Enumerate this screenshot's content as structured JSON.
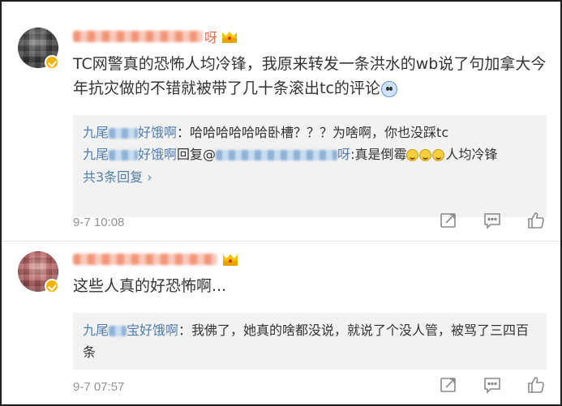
{
  "comments": [
    {
      "author_tail": "呀",
      "text": "TC网警真的恐怖人均冷锋，我原来转发一条洪水的wb说了句加拿大今年抗灾做的不错就被带了几十条滚出tc的评论",
      "replies": [
        {
          "name_prefix": "九尾",
          "name_suffix": "好饿啊",
          "sep": "：",
          "content": "哈哈哈哈哈哈卧槽？？？为啥啊，你也没踩tc"
        },
        {
          "name_prefix": "九尾",
          "name_suffix": "好饿啊",
          "reply_word": "回复@",
          "target_tail": "呀",
          "sep": ":",
          "content": "真是倒霉",
          "content_tail": "人均冷锋"
        }
      ],
      "more_replies": "共3条回复 ›",
      "time": "9-7 10:08"
    },
    {
      "author_tail": "",
      "text": "这些人真的好恐怖啊...",
      "replies": [
        {
          "name_prefix": "九尾",
          "name_suffix": "宝好饿啊",
          "sep": "：",
          "content": "我佛了，她真的啥都没说，就说了个没人管，被骂了三四百条"
        }
      ],
      "time": "9-7 07:57"
    }
  ],
  "colors": {
    "name": "#eb7350",
    "link": "#507daf",
    "muted": "#939393",
    "reply_bg": "#f2f2f2"
  },
  "icons": [
    "repost-icon",
    "comment-icon",
    "like-icon",
    "crown-icon",
    "verified-icon"
  ]
}
